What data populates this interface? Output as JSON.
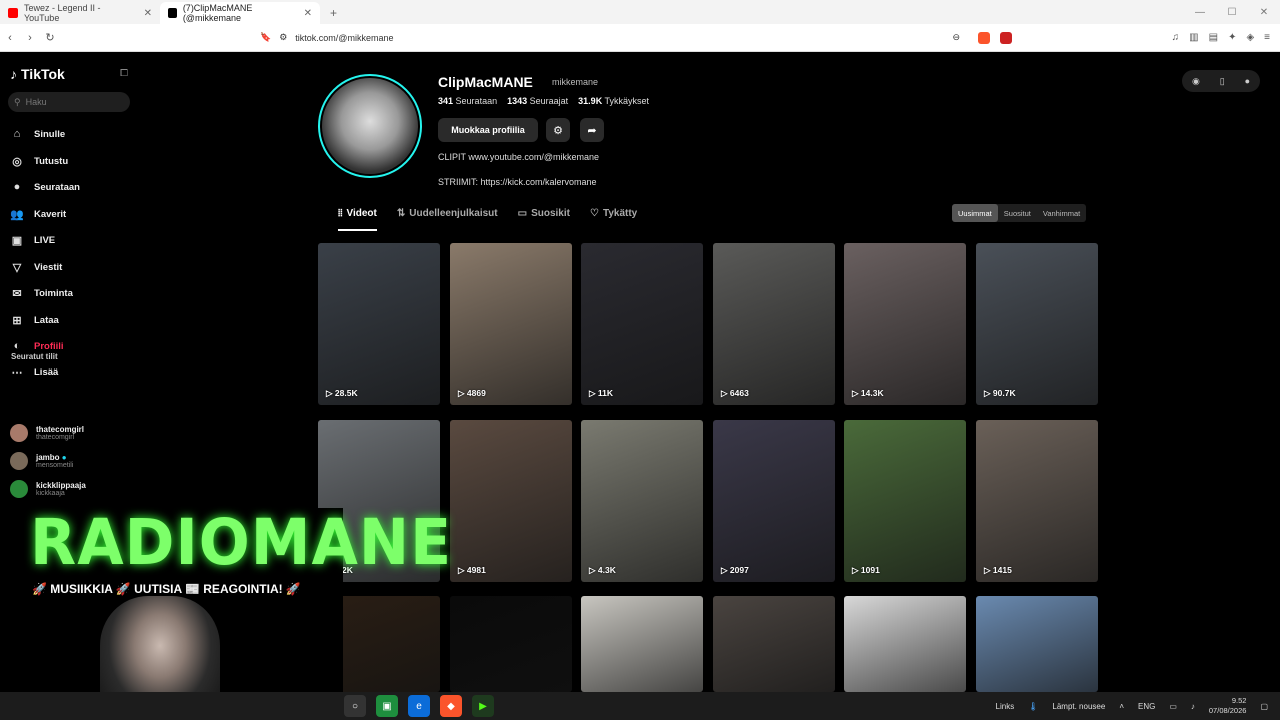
{
  "browser": {
    "tabs": [
      {
        "label": "Tewez - Legend II - YouTube",
        "active": false
      },
      {
        "label": "(7)ClipMacMANE (@mikkemane",
        "active": true
      }
    ],
    "url": "tiktok.com/@mikkemane"
  },
  "sidebar": {
    "logo": "TikTok",
    "search_placeholder": "Haku",
    "items": [
      {
        "label": "Sinulle",
        "icon": "home-icon"
      },
      {
        "label": "Tutustu",
        "icon": "compass-icon"
      },
      {
        "label": "Seurataan",
        "icon": "following-icon"
      },
      {
        "label": "Kaverit",
        "icon": "friends-icon"
      },
      {
        "label": "LIVE",
        "icon": "live-icon"
      },
      {
        "label": "Viestit",
        "icon": "messages-icon"
      },
      {
        "label": "Toiminta",
        "icon": "activity-icon"
      },
      {
        "label": "Lataa",
        "icon": "upload-icon"
      },
      {
        "label": "Profiili",
        "icon": "profile-icon"
      },
      {
        "label": "Lisää",
        "icon": "more-icon"
      }
    ],
    "following_header": "Seuratut tilit",
    "following": [
      {
        "name": "thatecomgirl",
        "handle": "thatecomgirl"
      },
      {
        "name": "jambo",
        "handle": "mensometili"
      },
      {
        "name": "kickklippaaja",
        "handle": "kickkaaja"
      }
    ]
  },
  "profile": {
    "name": "ClipMacMANE",
    "handle": "mikkemane",
    "following_count": "341",
    "following_label": "Seurataan",
    "followers_count": "1343",
    "followers_label": "Seuraajat",
    "likes_count": "31.9K",
    "likes_label": "Tykkäykset",
    "edit_label": "Muokkaa profiilia",
    "bio_line1": "CLIPIT www.youtube.com/@mikkemane",
    "bio_line2": "STRIIMIT: https://kick.com/kalervomane"
  },
  "tabs": {
    "videos": "Videot",
    "reposts": "Uudelleenjulkaisut",
    "favorites": "Suosikit",
    "liked": "Tykätty"
  },
  "sort": {
    "newest": "Uusimmat",
    "popular": "Suositut",
    "oldest": "Vanhimmat"
  },
  "videos": [
    {
      "views": "28.5K",
      "color": "#3a4048"
    },
    {
      "views": "4869",
      "color": "#8a7a6a"
    },
    {
      "views": "11K",
      "color": "#2a2a30"
    },
    {
      "views": "6463",
      "color": "#5a5a58"
    },
    {
      "views": "14.3K",
      "color": "#6a6060"
    },
    {
      "views": "90.7K",
      "color": "#4a5058"
    },
    {
      "views": "1.2K",
      "color": "#6a6e72"
    },
    {
      "views": "4981",
      "color": "#5a4a40"
    },
    {
      "views": "4.3K",
      "color": "#7a7a70"
    },
    {
      "views": "2097",
      "color": "#3a3848"
    },
    {
      "views": "1091",
      "color": "#4a6a3a"
    },
    {
      "views": "1415",
      "color": "#6a6058"
    },
    {
      "views": "",
      "color": "#2a1e14"
    },
    {
      "views": "",
      "color": "#0a0a0a"
    },
    {
      "views": "",
      "color": "#c8c6c0"
    },
    {
      "views": "",
      "color": "#4a4440"
    },
    {
      "views": "",
      "color": "#d8d8d8"
    },
    {
      "views": "",
      "color": "#6a8ab0"
    }
  ],
  "overlay": {
    "title": "RADIOMANE",
    "tagline": "🚀 MUSIIKKIA 🚀 UUTISIA 📰 REAGOINTIA! 🚀"
  },
  "taskbar": {
    "links": "Links",
    "weather": "Lämpt. nousee",
    "lang": "ENG",
    "time": "9.52",
    "date": "07/08/2026"
  }
}
